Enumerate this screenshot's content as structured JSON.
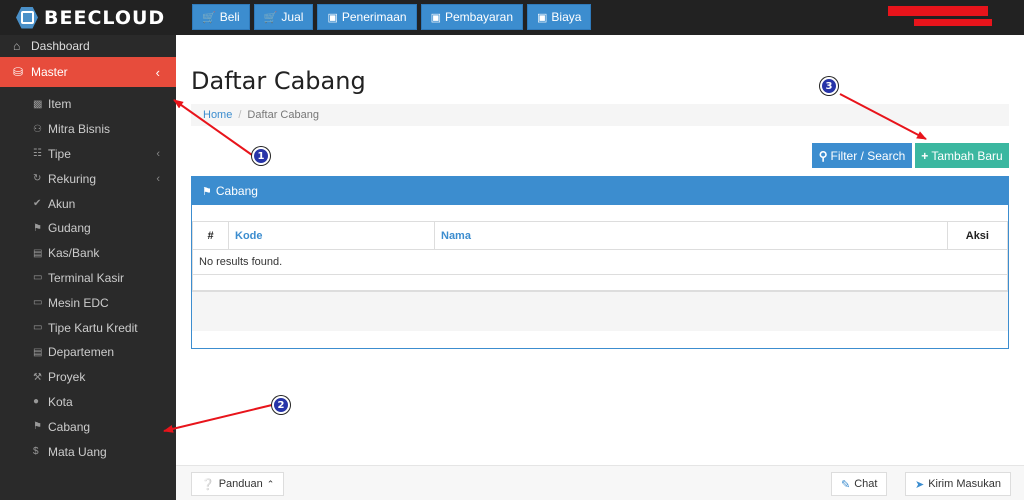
{
  "app": {
    "logo_text": "BEECLOUD"
  },
  "top_nav": [
    {
      "label": "Beli",
      "icon": "cart-icon"
    },
    {
      "label": "Jual",
      "icon": "cart-icon"
    },
    {
      "label": "Penerimaan",
      "icon": "money-icon"
    },
    {
      "label": "Pembayaran",
      "icon": "money-icon"
    },
    {
      "label": "Biaya",
      "icon": "money-icon"
    }
  ],
  "sidebar": {
    "dashboard": "Dashboard",
    "master": "Master",
    "items": [
      {
        "label": "Item"
      },
      {
        "label": "Mitra Bisnis"
      },
      {
        "label": "Tipe"
      },
      {
        "label": "Rekuring"
      },
      {
        "label": "Akun"
      },
      {
        "label": "Gudang"
      },
      {
        "label": "Kas/Bank"
      },
      {
        "label": "Terminal Kasir"
      },
      {
        "label": "Mesin EDC"
      },
      {
        "label": "Tipe Kartu Kredit"
      },
      {
        "label": "Departemen"
      },
      {
        "label": "Proyek"
      },
      {
        "label": "Kota"
      },
      {
        "label": "Cabang"
      },
      {
        "label": "Mata Uang"
      }
    ]
  },
  "main": {
    "title": "Daftar Cabang",
    "breadcrumb": {
      "home": "Home",
      "sep": "/",
      "current": "Daftar Cabang"
    },
    "filter_button": "Filter / Search",
    "add_button": "Tambah Baru",
    "panel_title": "Cabang",
    "table": {
      "headers": [
        "#",
        "Kode",
        "Nama",
        "Aksi"
      ],
      "empty_message": "No results found."
    }
  },
  "footer": {
    "panduan": "Panduan",
    "chat": "Chat",
    "kirim": "Kirim Masukan"
  },
  "annotations": [
    "1",
    "2",
    "3"
  ],
  "colors": {
    "accent_blue": "#3c8dcf",
    "master_red": "#e74c3c",
    "add_teal": "#3bb7a0",
    "arrow_red": "#e8141b"
  }
}
